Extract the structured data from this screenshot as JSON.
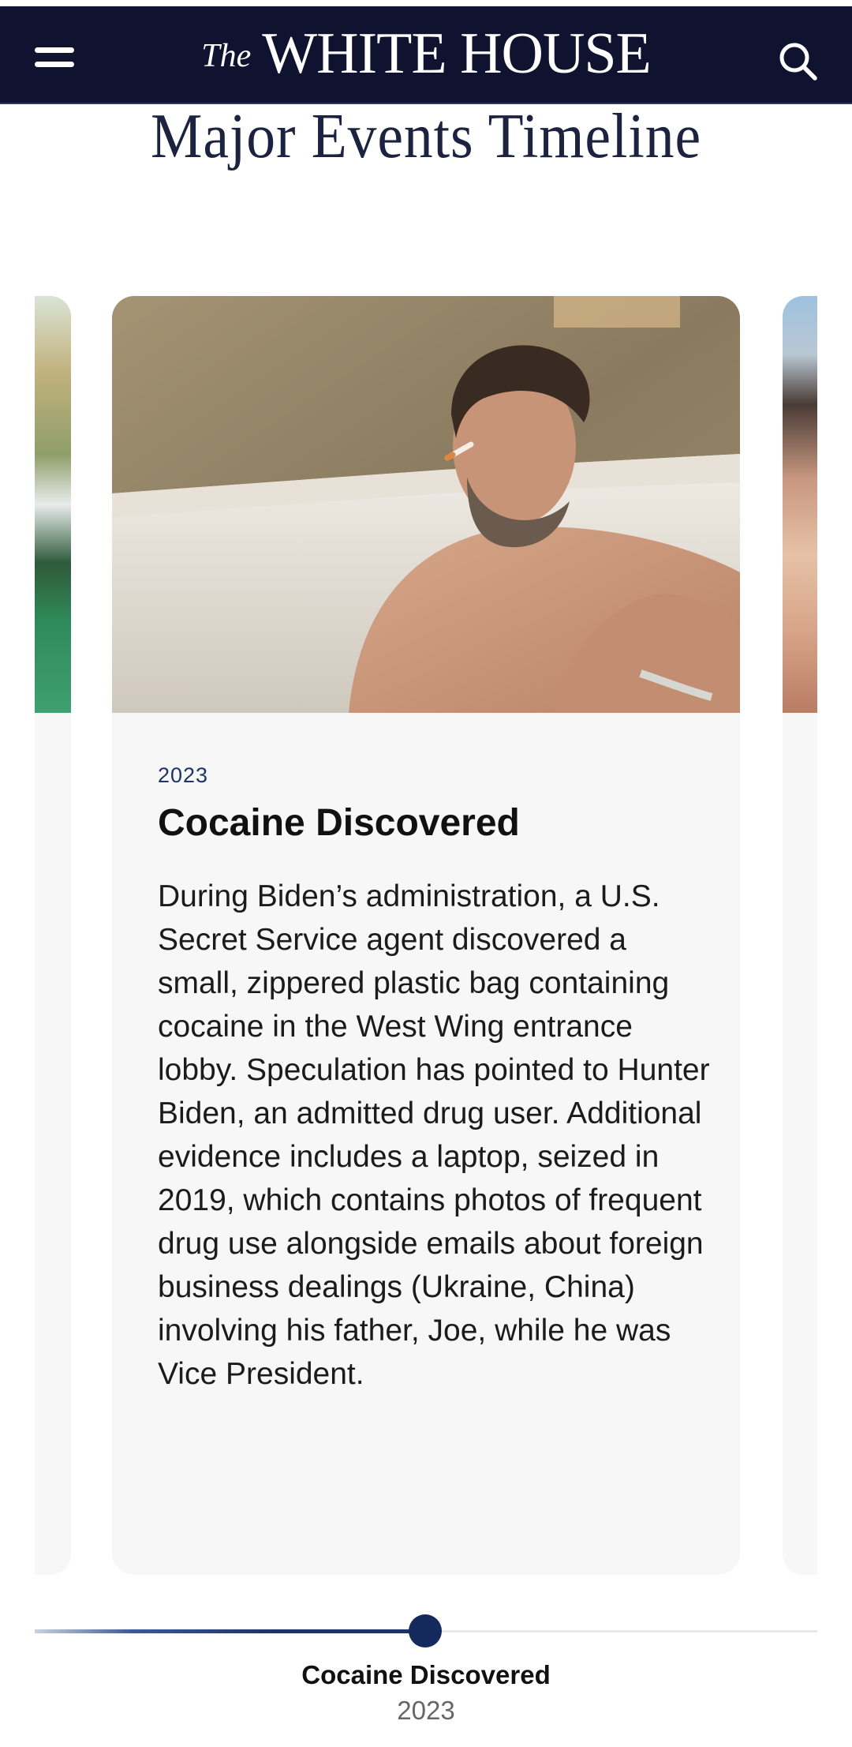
{
  "header": {
    "menu_icon": "hamburger-menu-icon",
    "brand_prefix": "The",
    "brand_name": "WHITE HOUSE",
    "search_icon": "search-icon",
    "background": "#0f1330"
  },
  "page": {
    "title": "Major Events Timeline"
  },
  "card": {
    "year": "2023",
    "title": "Cocaine Discovered",
    "body": "During Biden’s administration, a U.S. Secret Service agent discovered a small, zippered plastic bag containing cocaine in the West Wing entrance lobby. Speculation has pointed to Hunter Biden, an admitted drug user. Additional evidence includes a laptop, seized in 2019, which contains photos of frequent drug use alongside emails about foreign business dealings (Ukraine, China) involving his father, Joe, while he was Vice President."
  },
  "timeline": {
    "current_label": "Cocaine Discovered",
    "current_year": "2023",
    "accent": "#1d3566"
  }
}
